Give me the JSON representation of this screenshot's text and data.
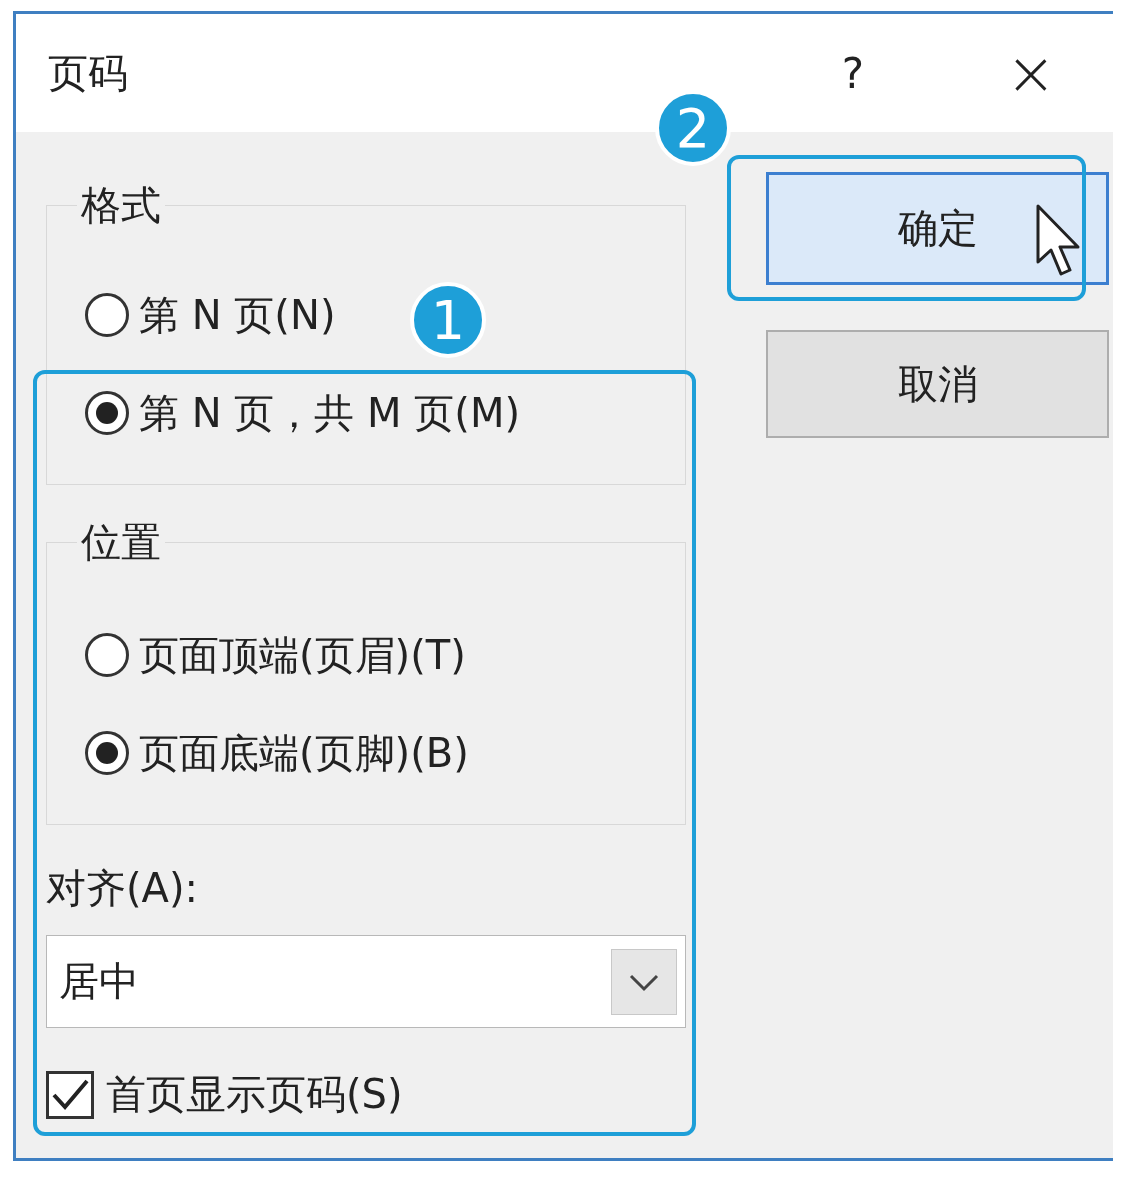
{
  "window": {
    "title": "页码",
    "help": "?",
    "close": "×"
  },
  "groups": [
    {
      "label": "格式",
      "options": [
        {
          "label": "第 N 页(N)",
          "selected": false
        },
        {
          "label": "第 N 页，共 M 页(M)",
          "selected": true
        }
      ]
    },
    {
      "label": "位置",
      "options": [
        {
          "label": "页面顶端(页眉)(T)",
          "selected": false
        },
        {
          "label": "页面底端(页脚)(B)",
          "selected": true
        }
      ]
    }
  ],
  "align": {
    "label": "对齐(A):",
    "value": "居中"
  },
  "checkbox": {
    "label": "首页显示页码(S)",
    "checked": true
  },
  "buttons": [
    {
      "label": "确定",
      "kind": "default"
    },
    {
      "label": "取消",
      "kind": "normal"
    }
  ],
  "annotations": [
    {
      "number": "1"
    },
    {
      "number": "2"
    }
  ]
}
